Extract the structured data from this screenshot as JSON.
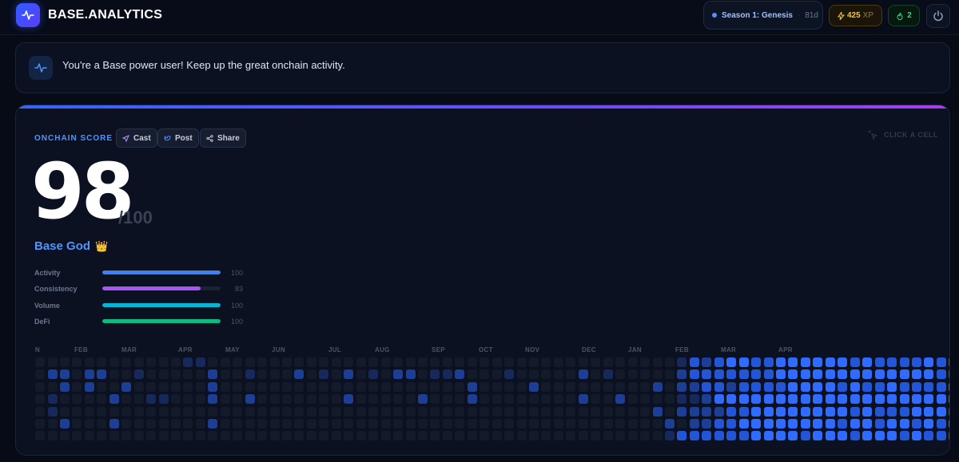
{
  "header": {
    "brand": "BASE.ANALYTICS",
    "season": "Season 1: Genesis",
    "season_days": "81d",
    "xp_value": "425",
    "xp_unit": "XP",
    "streak": "2"
  },
  "banner": {
    "text": "You're a Base power user! Keep up the great onchain activity."
  },
  "score_card": {
    "label": "ONCHAIN SCORE",
    "actions": [
      "Cast",
      "Post",
      "Share"
    ],
    "hint": "CLICK A CELL",
    "score": "98",
    "max": "/100",
    "tier": "Base God",
    "tier_emoji": "👑",
    "metrics": [
      {
        "name": "Activity",
        "value": "100",
        "fraction": 1.0,
        "color": "#3b82f6"
      },
      {
        "name": "Consistency",
        "value": "83",
        "fraction": 0.83,
        "color": "#a855f7"
      },
      {
        "name": "Volume",
        "value": "100",
        "fraction": 1.0,
        "color": "#06b6d4"
      },
      {
        "name": "DeFi",
        "value": "100",
        "fraction": 1.0,
        "color": "#10b981"
      }
    ]
  },
  "heatmap": {
    "months": [
      "N",
      "FEB",
      "MAR",
      "APR",
      "MAY",
      "JUN",
      "JUL",
      "AUG",
      "SEP",
      "OCT",
      "NOV",
      "DEC",
      "JAN",
      "FEB",
      "MAR",
      "APR"
    ],
    "colors": [
      "#131b2b",
      "#16295a",
      "#1c3f95",
      "#2256d6",
      "#2f6bff"
    ],
    "grid": [
      "00000000000011000000000000000000000000000000000000001323443344444434333343333343333",
      "02202200100000200100020102010220112000100000201000002333333344444444444443333434433",
      "00202002000000200000000000000000000200002000000000202233233334444343343333443433344",
      "01000020011000200200000002000002000200000000200200001124444444444444444444434334344",
      "01000000000000000000000000000000000000000000000000202222334444444434333444334343444",
      "00200020000000200000000000000000000000000000000000020223344444444344344343434344344",
      "00000000000000000000000000000000000000000000000000013333334444344434443433333333334"
    ]
  }
}
